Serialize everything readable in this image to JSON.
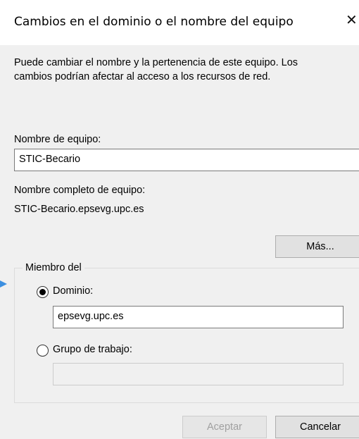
{
  "window": {
    "title": "Cambios en el dominio o el nombre del equipo",
    "close_glyph": "✕"
  },
  "description": {
    "line1": "Puede cambiar el nombre y la pertenencia de este equipo. Los",
    "line2": "cambios podrían afectar al acceso a los recursos de red."
  },
  "computer_name": {
    "label": "Nombre de equipo:",
    "value": "STIC-Becario"
  },
  "full_name": {
    "label": "Nombre completo de equipo:",
    "value": "STIC-Becario.epsevg.upc.es"
  },
  "more_button": {
    "label": "Más..."
  },
  "member_of": {
    "label": "Miembro del",
    "domain_label": "Dominio:",
    "domain_selected": true,
    "domain_value": "epsevg.upc.es",
    "workgroup_label": "Grupo de trabajo:",
    "workgroup_selected": false,
    "workgroup_value": ""
  },
  "buttons": {
    "ok": "Aceptar",
    "ok_enabled": false,
    "cancel": "Cancelar"
  },
  "colors": {
    "body_background": "#f0f0f0",
    "accent_marker": "#3c8fe0"
  }
}
